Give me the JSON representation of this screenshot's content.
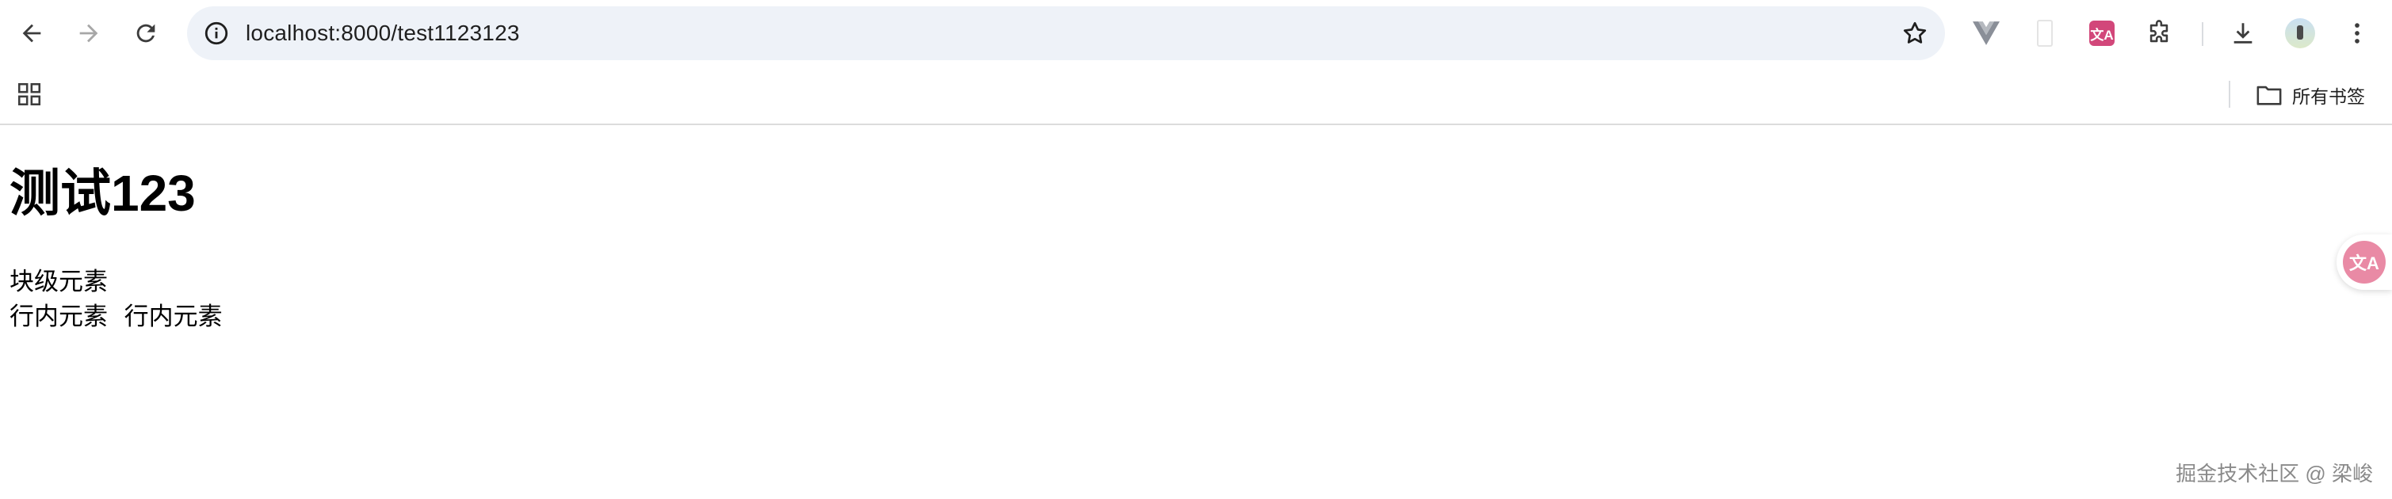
{
  "browser": {
    "url": "localhost:8000/test1123123",
    "bookmarks_bar": {
      "all_bookmarks_label": "所有书签"
    }
  },
  "page": {
    "title": "测试123",
    "block_element": "块级元素",
    "inline_elements": [
      "行内元素",
      "行内元素"
    ]
  },
  "watermark": "掘金技术社区 @ 梁峻",
  "colors": {
    "omnibox": "#eef2f8",
    "translate_badge": "#e98aa5",
    "vue_devtools": "#8a8f98"
  }
}
